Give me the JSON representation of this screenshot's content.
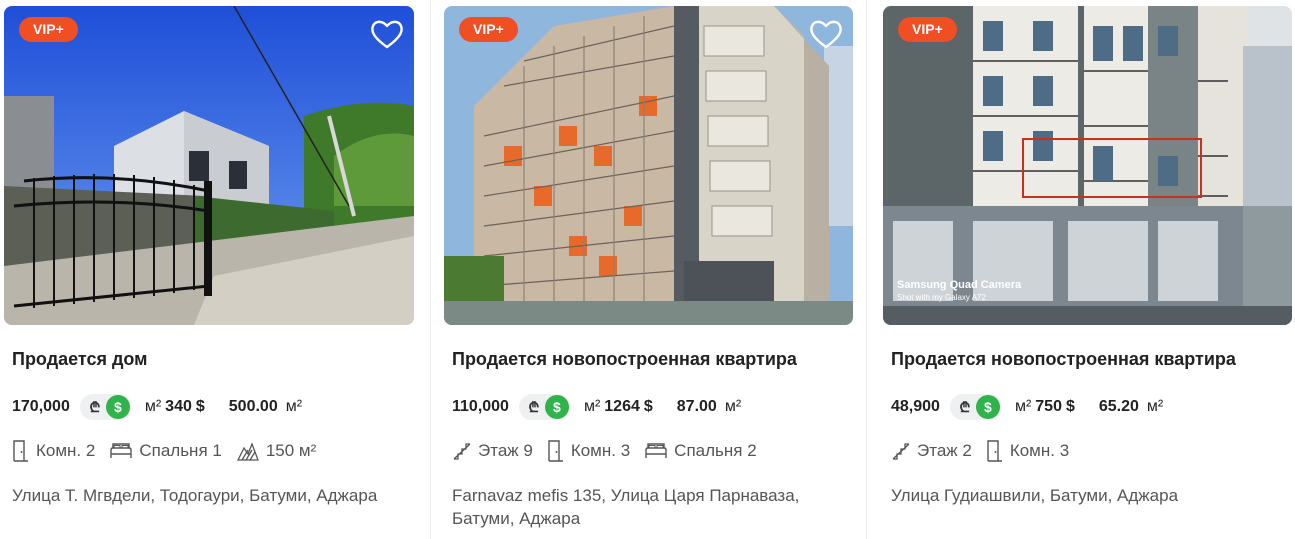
{
  "listings": [
    {
      "badge": "VIP+",
      "title": "Продается дом",
      "price": "170,000",
      "currency_gel": "₾",
      "currency_usd": "$",
      "area_unit": "м²",
      "area": "340",
      "area_cur": "$",
      "price_per_m2": "500.00",
      "per_unit": "м²",
      "features": [
        {
          "icon": "door-icon",
          "text": "Комн. 2"
        },
        {
          "icon": "bed-icon",
          "text": "Спальня 1"
        },
        {
          "icon": "land-area-icon",
          "text": "150 м²"
        }
      ],
      "address": "Улица Т. Мгвдели, Тодогаури, Батуми, Аджара"
    },
    {
      "badge": "VIP+",
      "title": "Продается новопостроенная квартира",
      "price": "110,000",
      "currency_gel": "₾",
      "currency_usd": "$",
      "area_unit": "м²",
      "area": "1264",
      "area_cur": "$",
      "price_per_m2": "87.00",
      "per_unit": "м²",
      "features": [
        {
          "icon": "stairs-icon",
          "text": "Этаж 9"
        },
        {
          "icon": "door-icon",
          "text": "Комн. 3"
        },
        {
          "icon": "bed-icon",
          "text": "Спальня 2"
        }
      ],
      "address": "Farnavaz mefis 135, Улица Царя Парнаваза, Батуми, Аджара"
    },
    {
      "badge": "VIP+",
      "title": "Продается новопостроенная квартира",
      "price": "48,900",
      "currency_gel": "₾",
      "currency_usd": "$",
      "area_unit": "м²",
      "area": "750",
      "area_cur": "$",
      "price_per_m2": "65.20",
      "per_unit": "м²",
      "features": [
        {
          "icon": "stairs-icon",
          "text": "Этаж 2"
        },
        {
          "icon": "door-icon",
          "text": "Комн. 3"
        }
      ],
      "address": "Улица Гудиашвили, Батуми, Аджара",
      "photo_caption_1": "Samsung Quad Camera",
      "photo_caption_2": "Shot with my Galaxy A72"
    }
  ],
  "colors": {
    "badge": "#f04e23",
    "usd_active": "#2fb34a",
    "switch_bg": "#eef0f2"
  }
}
